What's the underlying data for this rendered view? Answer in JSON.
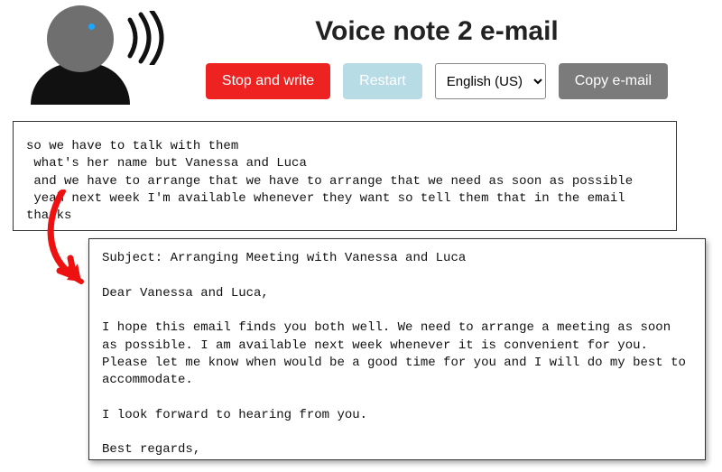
{
  "app": {
    "title": "Voice note 2 e-mail"
  },
  "controls": {
    "stop_label": "Stop and write",
    "restart_label": "Restart",
    "copy_label": "Copy e-mail",
    "language_selected": "English (US)"
  },
  "transcript": {
    "text": "so we have to talk with them\n what's her name but Vanessa and Luca\n and we have to arrange that we have to arrange that we need as soon as possible\n yeah next week I'm available whenever they want so tell them that in the email thanks"
  },
  "email": {
    "text": "Subject: Arranging Meeting with Vanessa and Luca\n\nDear Vanessa and Luca,\n\nI hope this email finds you both well. We need to arrange a meeting as soon as possible. I am available next week whenever it is convenient for you. Please let me know when would be a good time for you and I will do my best to accommodate.\n\nI look forward to hearing from you.\n\nBest regards,\n[Your Name]"
  },
  "icons": {
    "avatar": "speaking-avatar-icon",
    "waves": "sound-waves-icon",
    "arrow": "curved-arrow-icon"
  }
}
